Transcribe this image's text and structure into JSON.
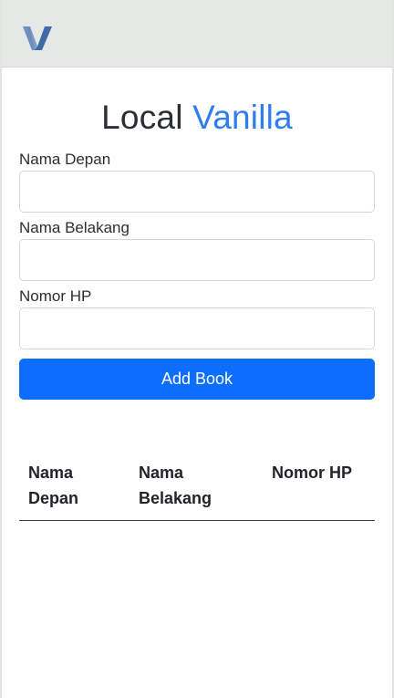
{
  "navbar": {
    "logo_icon": "vanilla-v-logo",
    "logo_color": "#4e74a7"
  },
  "header": {
    "title_main": "Local",
    "title_accent": "Vanilla",
    "accent_color": "#2f7df0"
  },
  "form": {
    "first_name_label": "Nama Depan",
    "first_name_value": "",
    "last_name_label": "Nama Belakang",
    "last_name_value": "",
    "phone_label": "Nomor HP",
    "phone_value": "",
    "submit_label": "Add Book",
    "submit_color": "#0d6efd"
  },
  "table": {
    "columns": [
      {
        "label": "Nama Depan"
      },
      {
        "label": "Nama Belakang"
      },
      {
        "label": "Nomor HP"
      }
    ],
    "rows": []
  }
}
